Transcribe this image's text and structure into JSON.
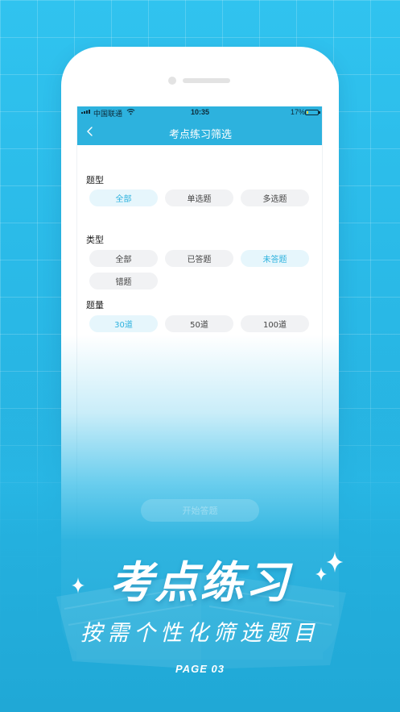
{
  "status_bar": {
    "carrier": "中国联通",
    "time": "10:35",
    "battery": "17%",
    "battery_level": 0.17,
    "icons": [
      "signal-icon",
      "wifi-icon",
      "battery-icon"
    ]
  },
  "nav": {
    "title": "考点练习筛选",
    "back_icon": "chevron-left-icon"
  },
  "filters": {
    "question_type": {
      "label": "题型",
      "options": [
        "全部",
        "单选题",
        "多选题"
      ],
      "selected": "全部"
    },
    "category": {
      "label": "类型",
      "options": [
        "全部",
        "已答题",
        "未答题",
        "错题"
      ],
      "selected": "未答题"
    },
    "quantity": {
      "label": "题量",
      "options": [
        "30道",
        "50道",
        "100道"
      ],
      "selected": "30道"
    }
  },
  "start_button": "开始答题",
  "promo": {
    "headline": "考点练习",
    "subheadline": "按需个性化筛选题目",
    "page_label": "PAGE 03"
  },
  "colors": {
    "accent": "#2db2de",
    "background": "#30c3ef",
    "chip_bg": "#f1f2f4",
    "chip_selected_bg": "#e6f6fc"
  }
}
